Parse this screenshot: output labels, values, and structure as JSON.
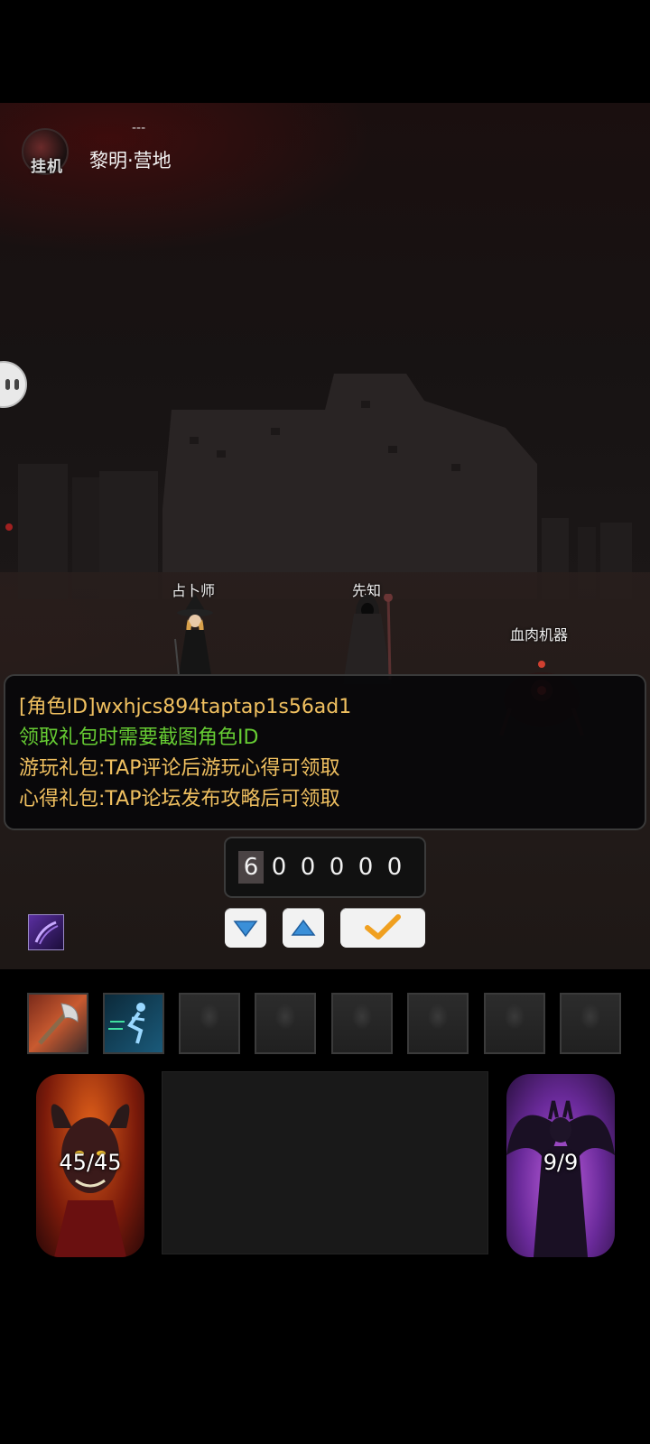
{
  "header": {
    "logo_text": "挂机",
    "top_label": "---",
    "location": "黎明·营地"
  },
  "npcs": [
    {
      "name": "占卜师"
    },
    {
      "name": "先知"
    },
    {
      "name": "血肉机器"
    }
  ],
  "info_panel": {
    "line1": "[角色ID]wxhjcs894taptap1s56ad1",
    "line2": "领取礼包时需要截图角色ID",
    "line3": "游玩礼包:TAP评论后游玩心得可领取",
    "line4": "心得礼包:TAP论坛发布攻略后可领取",
    "colors": {
      "line1": "#f0c060",
      "line2": "#66cc33",
      "line3": "#f0c060",
      "line4": "#f0c060"
    }
  },
  "code_input": {
    "digits": [
      "6",
      "0",
      "0",
      "0",
      "0",
      "0"
    ],
    "active_index": 0
  },
  "buttons": {
    "down_icon": "triangle-down-icon",
    "up_icon": "triangle-up-icon",
    "confirm_icon": "checkmark-icon"
  },
  "skill_bar": {
    "slots": [
      {
        "icon": "axe-skill-icon",
        "state": "filled"
      },
      {
        "icon": "sprint-skill-icon",
        "state": "filled"
      },
      {
        "icon": "locked-hooded-figure-icon",
        "state": "empty"
      },
      {
        "icon": "locked-hooded-figure-icon",
        "state": "empty"
      },
      {
        "icon": "locked-hooded-figure-icon",
        "state": "empty"
      },
      {
        "icon": "locked-hooded-figure-icon",
        "state": "empty"
      },
      {
        "icon": "locked-hooded-figure-icon",
        "state": "empty"
      },
      {
        "icon": "locked-hooded-figure-icon",
        "state": "empty"
      }
    ]
  },
  "player": {
    "hp_text": "45/45"
  },
  "mana": {
    "text": "9/9"
  }
}
